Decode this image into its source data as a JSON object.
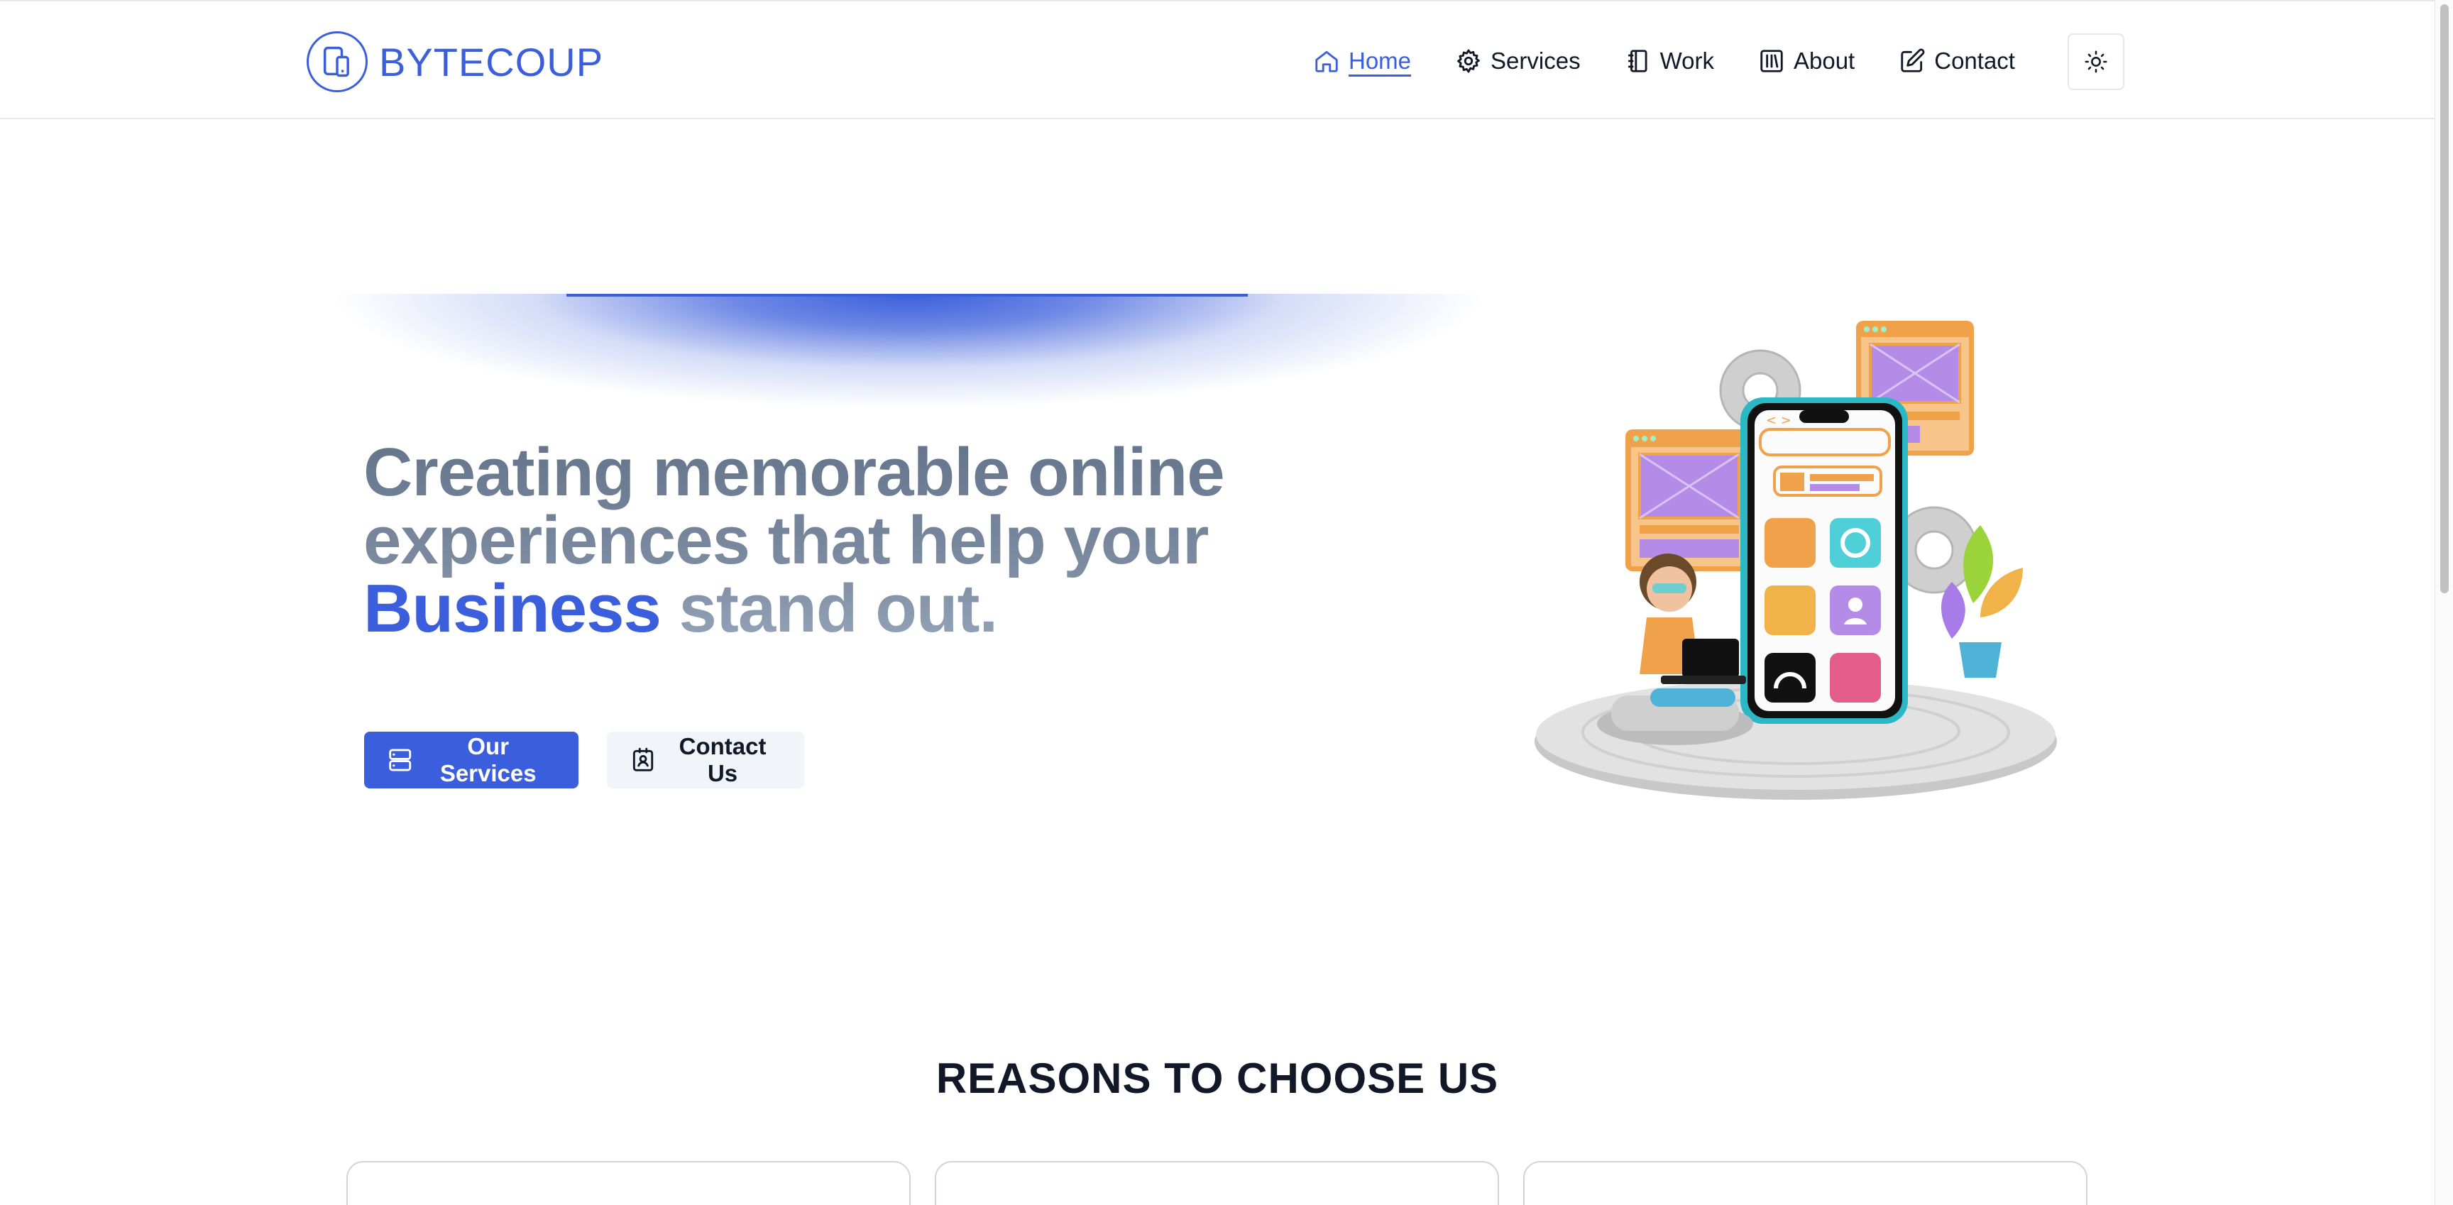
{
  "header": {
    "brand": "BYTECOUP",
    "nav": [
      {
        "label": "Home",
        "icon": "home-icon",
        "active": true
      },
      {
        "label": "Services",
        "icon": "gear-icon"
      },
      {
        "label": "Work",
        "icon": "notebook-icon"
      },
      {
        "label": "About",
        "icon": "library-icon"
      },
      {
        "label": "Contact",
        "icon": "edit-icon"
      }
    ],
    "theme_toggle_icon": "sun-icon"
  },
  "hero": {
    "headline_part1": "Creating memorable online experiences that help your ",
    "headline_accent": "Business",
    "headline_part2": " stand out.",
    "primary_button": "Our Services",
    "secondary_button": "Contact Us"
  },
  "reasons": {
    "title": "REASONS TO CHOOSE US"
  },
  "colors": {
    "accent": "#3b5fdc",
    "heading_gray": "#64748b",
    "border": "#e5e7eb"
  }
}
